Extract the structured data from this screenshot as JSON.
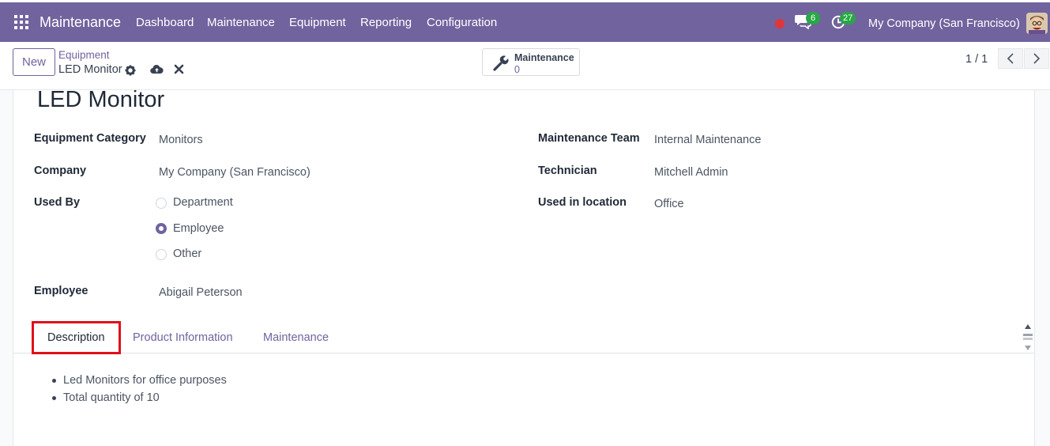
{
  "navbar": {
    "app_name": "Maintenance",
    "menus": [
      "Dashboard",
      "Maintenance",
      "Equipment",
      "Reporting",
      "Configuration"
    ],
    "messages_count": "6",
    "activities_count": "27",
    "company": "My Company (San Francisco)",
    "accent_color": "#71639e"
  },
  "control": {
    "new_label": "New",
    "breadcrumb_parent": "Equipment",
    "breadcrumb_current": "LED Monitor",
    "smart_button": {
      "label": "Maintenance",
      "value": "0"
    },
    "pager": "1 / 1"
  },
  "form": {
    "title": "LED Monitor",
    "left_fields": [
      {
        "label": "Equipment Category",
        "value": "Monitors"
      },
      {
        "label": "Company",
        "value": "My Company (San Francisco)"
      },
      {
        "label": "Used By",
        "value": "Employee"
      },
      {
        "label": "Employee",
        "value": "Abigail Peterson"
      }
    ],
    "used_by_options": [
      "Department",
      "Employee",
      "Other"
    ],
    "right_fields": [
      {
        "label": "Maintenance Team",
        "value": "Internal Maintenance"
      },
      {
        "label": "Technician",
        "value": "Mitchell Admin"
      },
      {
        "label": "Used in location",
        "value": "Office"
      }
    ]
  },
  "tabs": [
    "Description",
    "Product Information",
    "Maintenance"
  ],
  "active_tab": "Description",
  "description_items": [
    "Led Monitors for office purposes",
    "Total quantity of 10"
  ],
  "highlight_color": "#e0101a"
}
